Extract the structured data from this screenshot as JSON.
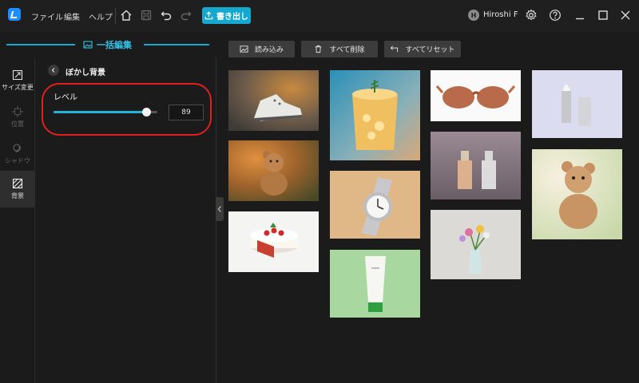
{
  "menu": {
    "file": "ファイル",
    "edit": "編集",
    "help": "ヘルプ"
  },
  "toolbar": {
    "export_label": "書き出し"
  },
  "user": {
    "initial": "H",
    "name": "Hiroshi F"
  },
  "section": {
    "title": "一括編集"
  },
  "sidenav": [
    {
      "label": "サイズ変更",
      "icon": "resize-icon",
      "state": "enabled"
    },
    {
      "label": "位置",
      "icon": "position-icon",
      "state": "disabled"
    },
    {
      "label": "シャドウ",
      "icon": "shadow-icon",
      "state": "disabled"
    },
    {
      "label": "背景",
      "icon": "background-icon",
      "state": "active"
    }
  ],
  "panel": {
    "title": "ぼかし背景",
    "level_label": "レベル",
    "level_value": "89",
    "level_fraction": 0.89
  },
  "actions": {
    "load": "読み込み",
    "delete_all": "すべて削除",
    "reset_all": "すべてリセット"
  },
  "images": [
    {
      "subject": "sneaker"
    },
    {
      "subject": "teddy-bear"
    },
    {
      "subject": "cake"
    },
    {
      "subject": "juice-glass"
    },
    {
      "subject": "wristwatch"
    },
    {
      "subject": "cream-tube"
    },
    {
      "subject": "sunglasses"
    },
    {
      "subject": "perfume-bottles"
    },
    {
      "subject": "flower-vase"
    },
    {
      "subject": "lipstick"
    },
    {
      "subject": "teddy-bear"
    }
  ],
  "colors": {
    "accent": "#16a9cf",
    "annotation": "#e0201f"
  }
}
